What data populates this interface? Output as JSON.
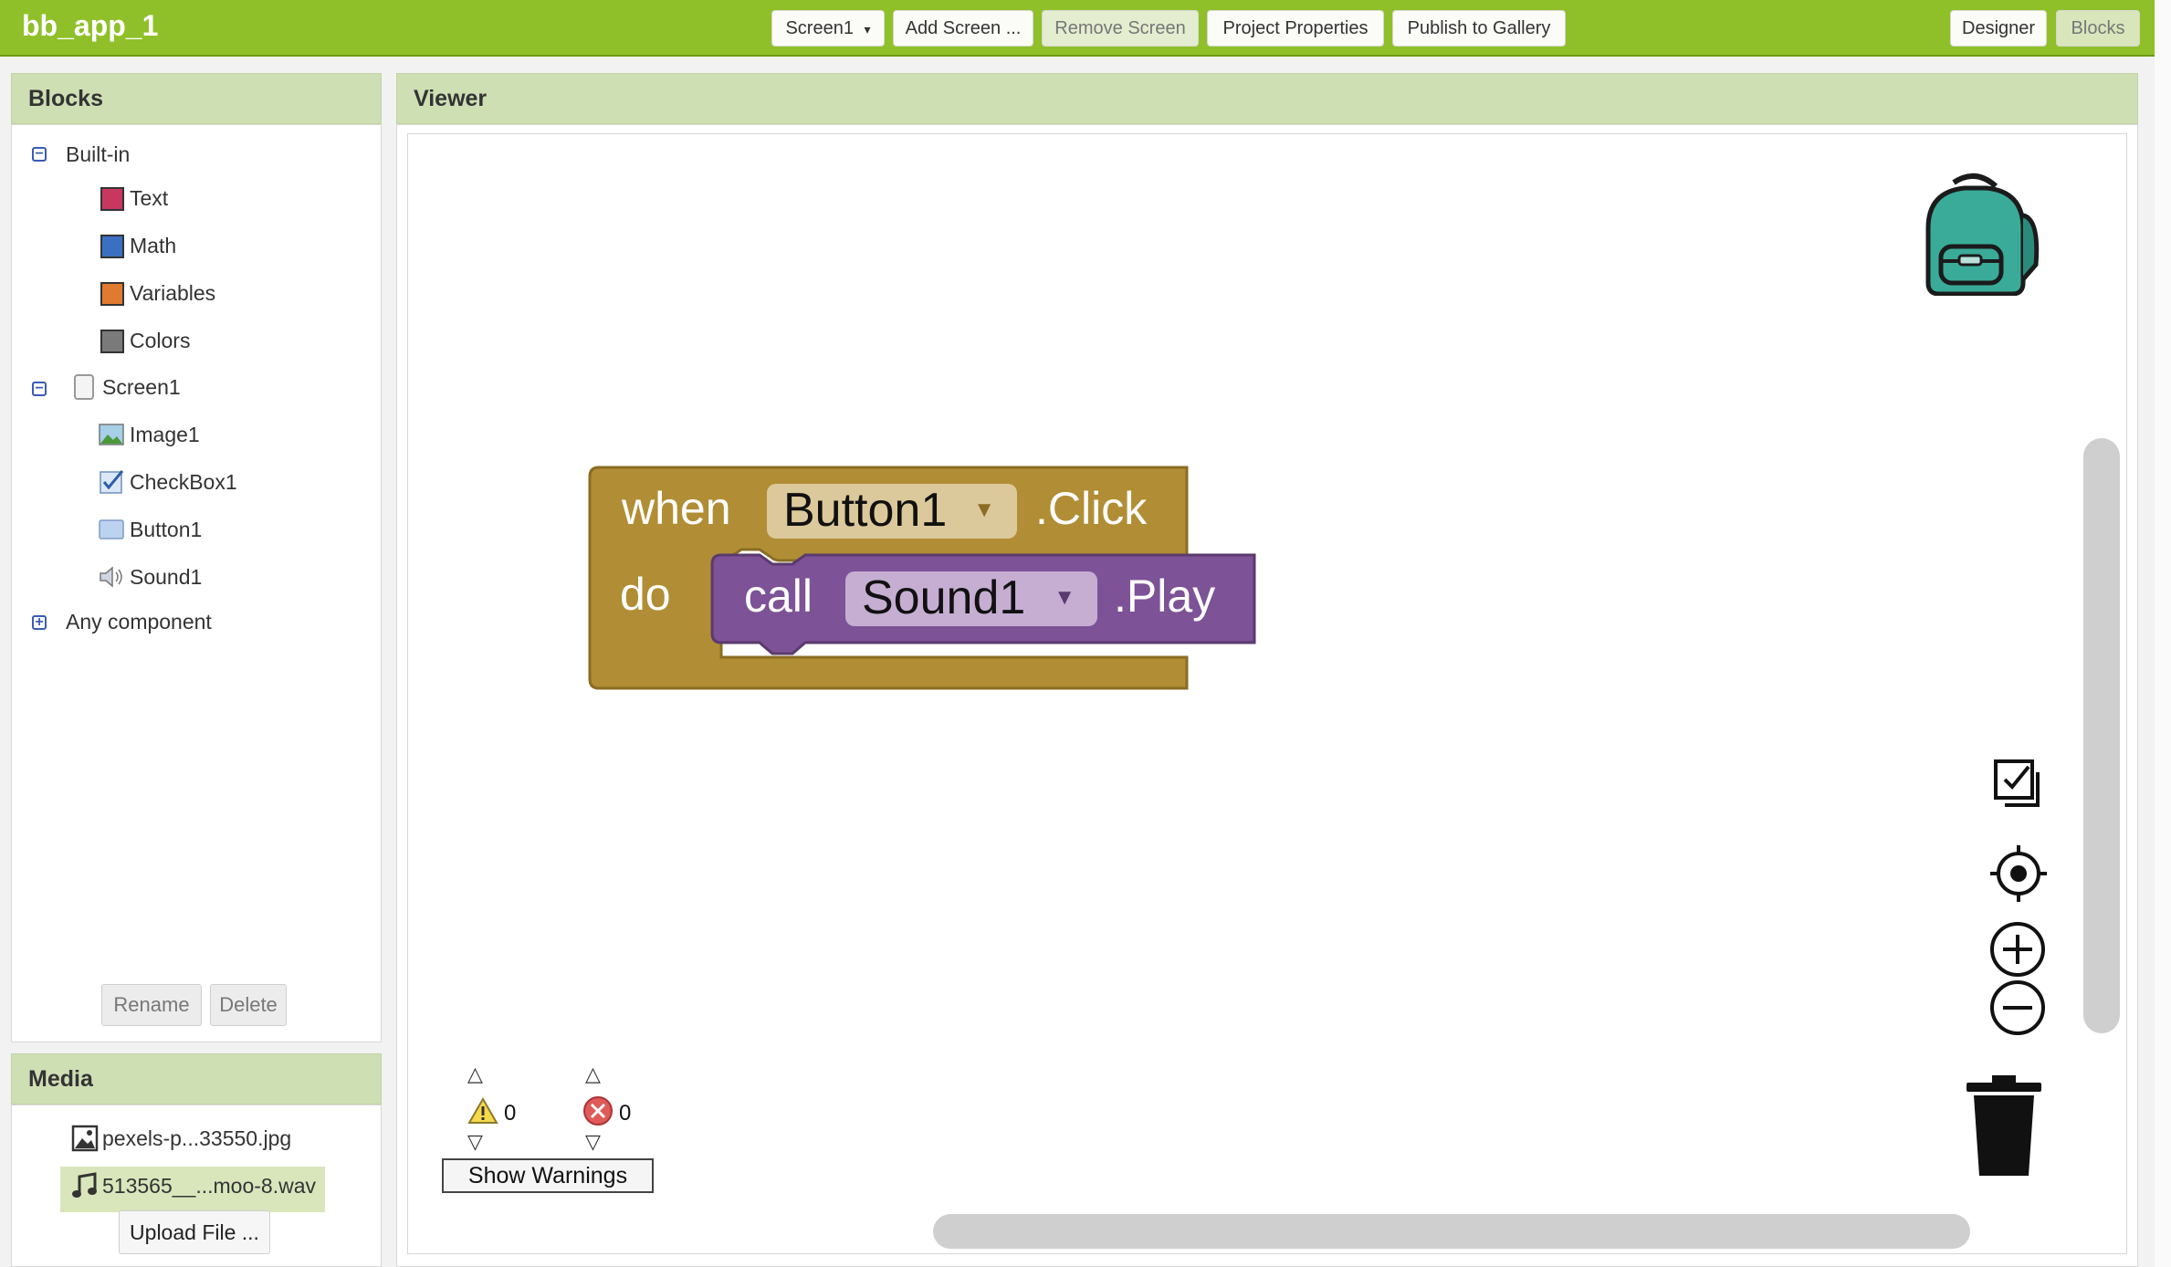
{
  "app": {
    "title": "bb_app_1"
  },
  "toolbar": {
    "screen_select": "Screen1",
    "screen_select_arrow": "▾",
    "add_screen": "Add Screen ...",
    "remove_screen": "Remove Screen",
    "project_properties": "Project Properties",
    "publish": "Publish to Gallery",
    "designer": "Designer",
    "blocks": "Blocks"
  },
  "blocks_panel": {
    "title": "Blocks",
    "builtin": {
      "label": "Built-in",
      "toggle": "−",
      "items": [
        {
          "label": "Text",
          "color": "#c8375f"
        },
        {
          "label": "Math",
          "color": "#3b6fc2"
        },
        {
          "label": "Variables",
          "color": "#e07a30"
        },
        {
          "label": "Colors",
          "color": "#7a7a7a"
        }
      ]
    },
    "screen": {
      "label": "Screen1",
      "toggle": "−",
      "items": [
        {
          "label": "Image1",
          "icon": "image-icon"
        },
        {
          "label": "CheckBox1",
          "icon": "checkbox-icon"
        },
        {
          "label": "Button1",
          "icon": "button-icon"
        },
        {
          "label": "Sound1",
          "icon": "sound-icon"
        }
      ]
    },
    "any_component": {
      "label": "Any component",
      "toggle": "+"
    },
    "rename": "Rename",
    "delete": "Delete"
  },
  "media_panel": {
    "title": "Media",
    "files": [
      {
        "name": "pexels-p...33550.jpg",
        "icon": "image-file-icon"
      },
      {
        "name": "513565__...moo-8.wav",
        "icon": "music-file-icon"
      }
    ],
    "upload": "Upload File ..."
  },
  "viewer": {
    "title": "Viewer",
    "event_block": {
      "keyword": "when",
      "component": "Button1",
      "event": ".Click",
      "do": "do",
      "color": "#b18e35"
    },
    "call_block": {
      "keyword": "call",
      "component": "Sound1",
      "method": ".Play",
      "color": "#7d5296"
    },
    "dropdown_arrow": "▼",
    "warnings": {
      "count": "0",
      "arrow_up": "△",
      "arrow_down": "▽"
    },
    "errors": {
      "count": "0",
      "arrow_up": "△",
      "arrow_down": "▽"
    },
    "show_warnings": "Show Warnings"
  }
}
